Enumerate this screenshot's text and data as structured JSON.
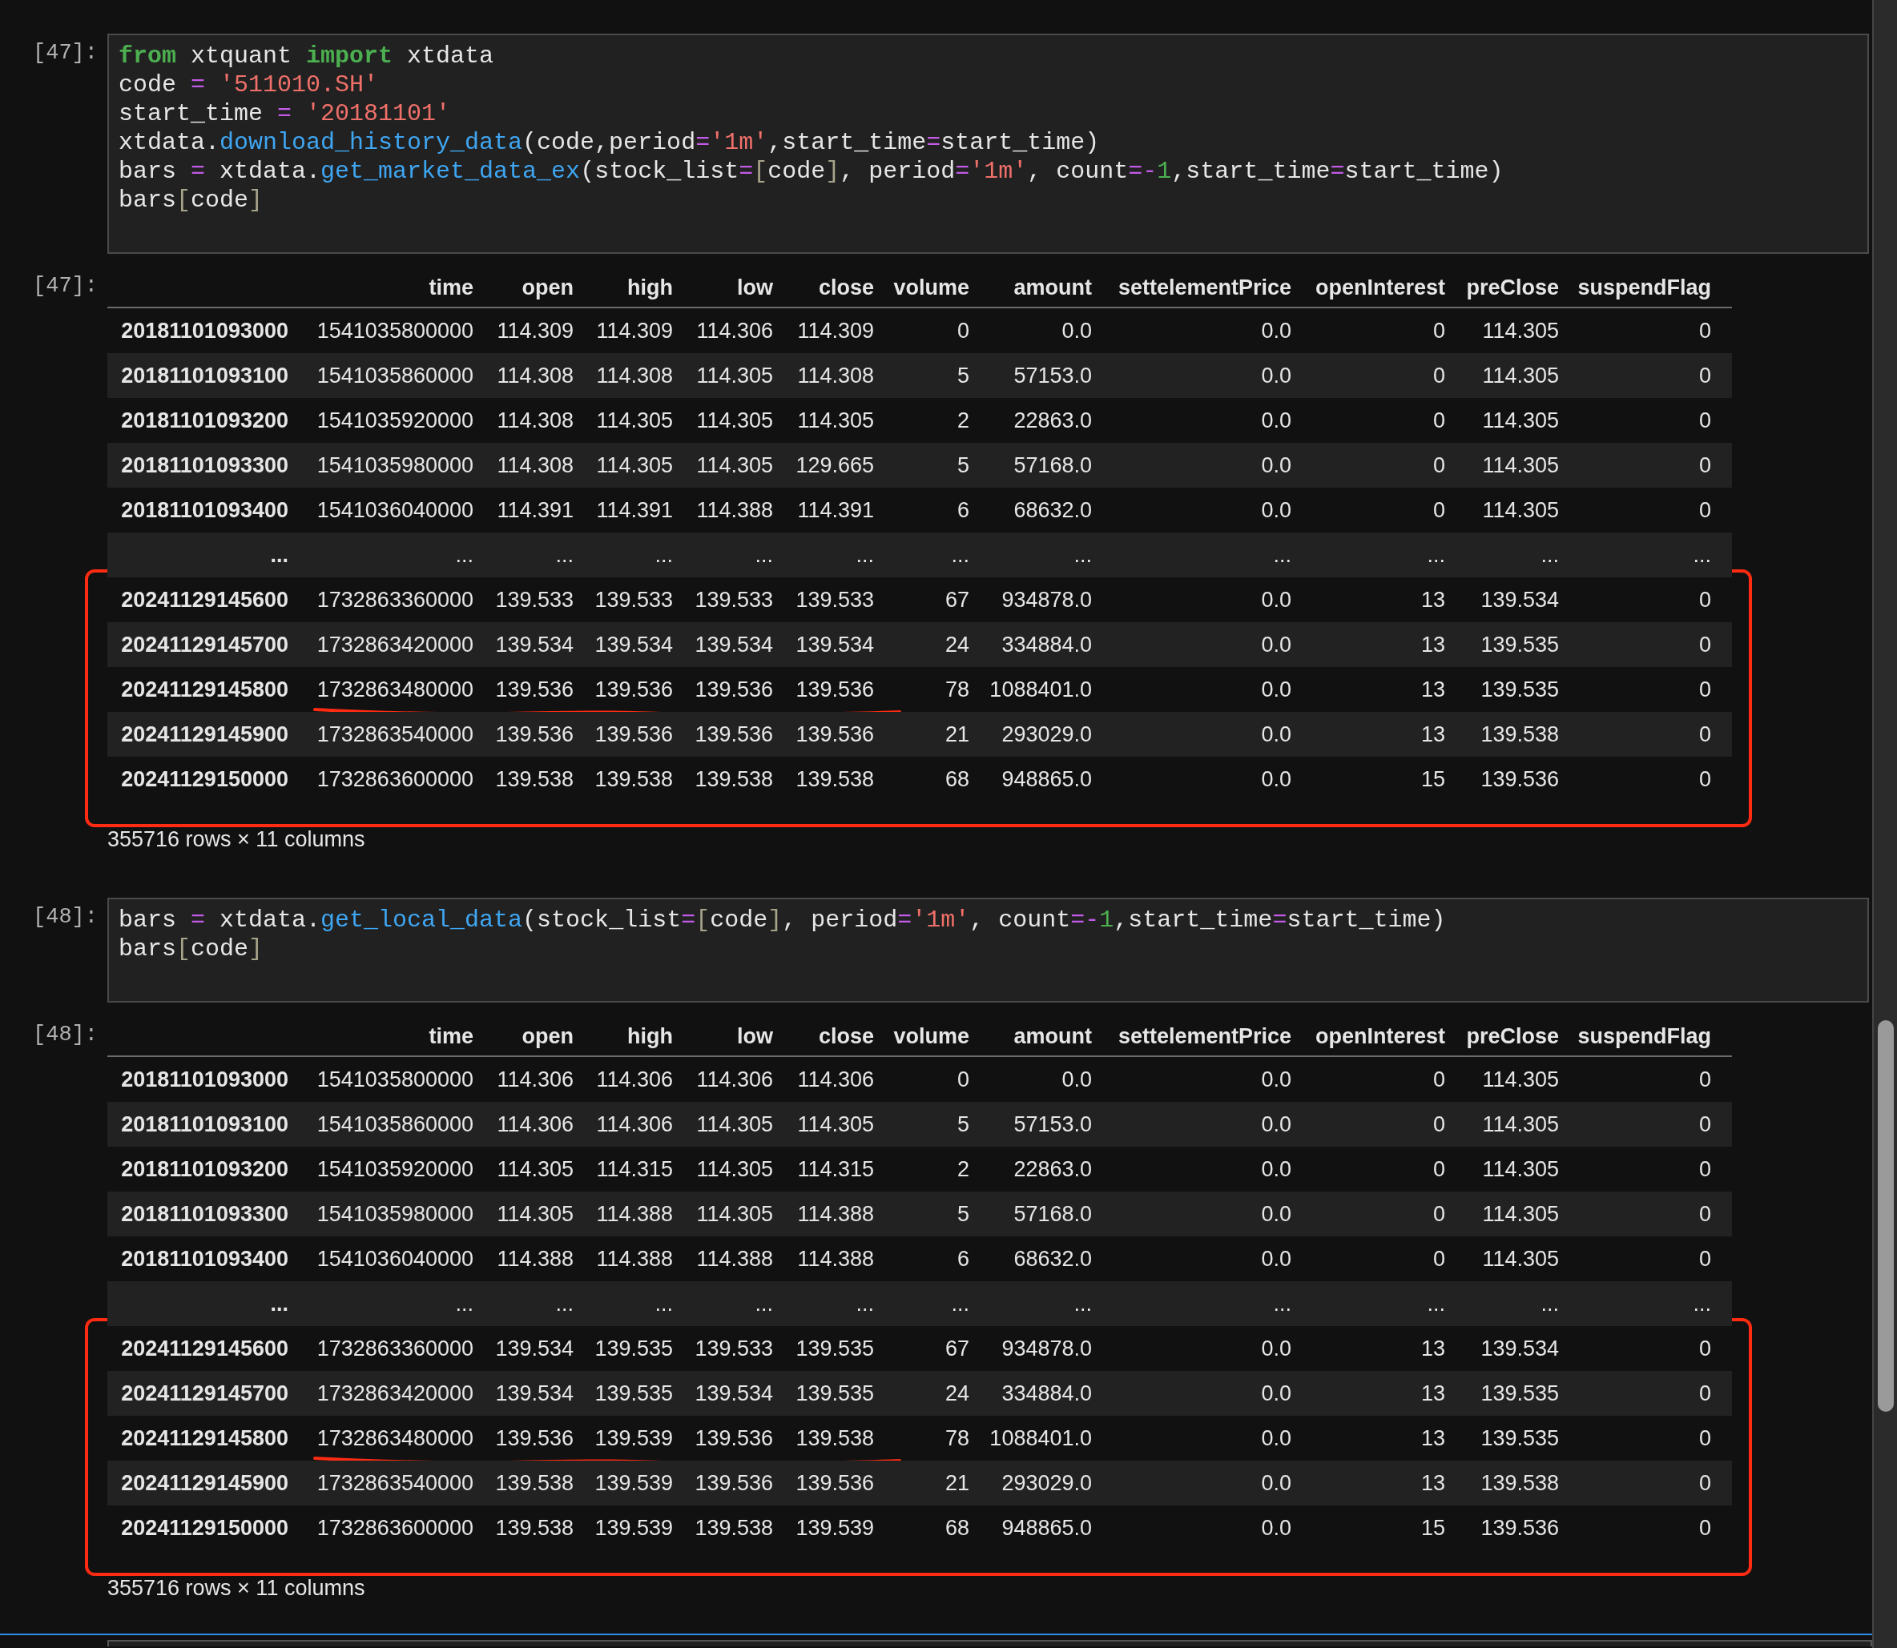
{
  "cells": [
    {
      "prompt": "[47]:",
      "code": [
        [
          {
            "kind": "keyword",
            "text": "from"
          },
          {
            "kind": "plain",
            "text": " xtquant "
          },
          {
            "kind": "keyword",
            "text": "import"
          },
          {
            "kind": "plain",
            "text": " xtdata"
          }
        ],
        [
          {
            "kind": "plain",
            "text": "code "
          },
          {
            "kind": "operator",
            "text": "="
          },
          {
            "kind": "string",
            "text": " '511010.SH'"
          }
        ],
        [
          {
            "kind": "plain",
            "text": "start_time "
          },
          {
            "kind": "operator",
            "text": "="
          },
          {
            "kind": "string",
            "text": " '20181101'"
          }
        ],
        [
          {
            "kind": "plain",
            "text": "xtdata."
          },
          {
            "kind": "function",
            "text": "download_history_data"
          },
          {
            "kind": "plain",
            "text": "(code,period"
          },
          {
            "kind": "operator",
            "text": "="
          },
          {
            "kind": "string",
            "text": "'1m'"
          },
          {
            "kind": "plain",
            "text": ",start_time"
          },
          {
            "kind": "operator",
            "text": "="
          },
          {
            "kind": "plain",
            "text": "start_time)"
          }
        ],
        [
          {
            "kind": "plain",
            "text": "bars "
          },
          {
            "kind": "operator",
            "text": "="
          },
          {
            "kind": "plain",
            "text": " xtdata."
          },
          {
            "kind": "function",
            "text": "get_market_data_ex"
          },
          {
            "kind": "plain",
            "text": "(stock_list"
          },
          {
            "kind": "operator",
            "text": "="
          },
          {
            "kind": "bracket",
            "text": "["
          },
          {
            "kind": "plain",
            "text": "code"
          },
          {
            "kind": "bracket",
            "text": "]"
          },
          {
            "kind": "plain",
            "text": ", period"
          },
          {
            "kind": "operator",
            "text": "="
          },
          {
            "kind": "string",
            "text": "'1m'"
          },
          {
            "kind": "plain",
            "text": ", count"
          },
          {
            "kind": "operator",
            "text": "=-"
          },
          {
            "kind": "number",
            "text": "1"
          },
          {
            "kind": "plain",
            "text": ",start_time"
          },
          {
            "kind": "operator",
            "text": "="
          },
          {
            "kind": "plain",
            "text": "start_time)"
          }
        ],
        [
          {
            "kind": "plain",
            "text": "bars"
          },
          {
            "kind": "bracket",
            "text": "["
          },
          {
            "kind": "plain",
            "text": "code"
          },
          {
            "kind": "bracket",
            "text": "]"
          }
        ]
      ],
      "output": {
        "prompt": "[47]:",
        "columns": [
          "time",
          "open",
          "high",
          "low",
          "close",
          "volume",
          "amount",
          "settelementPrice",
          "openInterest",
          "preClose",
          "suspendFlag"
        ],
        "rows": [
          {
            "index": "20181101093000",
            "cells": [
              "1541035800000",
              "114.309",
              "114.309",
              "114.306",
              "114.309",
              "0",
              "0.0",
              "0.0",
              "0",
              "114.305",
              "0"
            ]
          },
          {
            "index": "20181101093100",
            "cells": [
              "1541035860000",
              "114.308",
              "114.308",
              "114.305",
              "114.308",
              "5",
              "57153.0",
              "0.0",
              "0",
              "114.305",
              "0"
            ]
          },
          {
            "index": "20181101093200",
            "cells": [
              "1541035920000",
              "114.308",
              "114.305",
              "114.305",
              "114.305",
              "2",
              "22863.0",
              "0.0",
              "0",
              "114.305",
              "0"
            ]
          },
          {
            "index": "20181101093300",
            "cells": [
              "1541035980000",
              "114.308",
              "114.305",
              "114.305",
              "129.665",
              "5",
              "57168.0",
              "0.0",
              "0",
              "114.305",
              "0"
            ]
          },
          {
            "index": "20181101093400",
            "cells": [
              "1541036040000",
              "114.391",
              "114.391",
              "114.388",
              "114.391",
              "6",
              "68632.0",
              "0.0",
              "0",
              "114.305",
              "0"
            ]
          },
          {
            "index": "...",
            "cells": [
              "...",
              "...",
              "...",
              "...",
              "...",
              "...",
              "...",
              "...",
              "...",
              "...",
              "..."
            ]
          }
        ],
        "highlight": {
          "rows": [
            {
              "index": "20241129145600",
              "cells": [
                "1732863360000",
                "139.533",
                "139.533",
                "139.533",
                "139.533",
                "67",
                "934878.0",
                "0.0",
                "13",
                "139.534",
                "0"
              ],
              "underlined": false
            },
            {
              "index": "20241129145700",
              "cells": [
                "1732863420000",
                "139.534",
                "139.534",
                "139.534",
                "139.534",
                "24",
                "334884.0",
                "0.0",
                "13",
                "139.535",
                "0"
              ],
              "underlined": false
            },
            {
              "index": "20241129145800",
              "cells": [
                "1732863480000",
                "139.536",
                "139.536",
                "139.536",
                "139.536",
                "78",
                "1088401.0",
                "0.0",
                "13",
                "139.535",
                "0"
              ],
              "underlined": true
            },
            {
              "index": "20241129145900",
              "cells": [
                "1732863540000",
                "139.536",
                "139.536",
                "139.536",
                "139.536",
                "21",
                "293029.0",
                "0.0",
                "13",
                "139.538",
                "0"
              ],
              "underlined": false
            },
            {
              "index": "20241129150000",
              "cells": [
                "1732863600000",
                "139.538",
                "139.538",
                "139.538",
                "139.538",
                "68",
                "948865.0",
                "0.0",
                "15",
                "139.536",
                "0"
              ],
              "underlined": false
            }
          ]
        },
        "footer": "355716 rows × 11 columns"
      }
    },
    {
      "prompt": "[48]:",
      "code": [
        [
          {
            "kind": "plain",
            "text": "bars "
          },
          {
            "kind": "operator",
            "text": "="
          },
          {
            "kind": "plain",
            "text": " xtdata."
          },
          {
            "kind": "function",
            "text": "get_local_data"
          },
          {
            "kind": "plain",
            "text": "(stock_list"
          },
          {
            "kind": "operator",
            "text": "="
          },
          {
            "kind": "bracket",
            "text": "["
          },
          {
            "kind": "plain",
            "text": "code"
          },
          {
            "kind": "bracket",
            "text": "]"
          },
          {
            "kind": "plain",
            "text": ", period"
          },
          {
            "kind": "operator",
            "text": "="
          },
          {
            "kind": "string",
            "text": "'1m'"
          },
          {
            "kind": "plain",
            "text": ", count"
          },
          {
            "kind": "operator",
            "text": "=-"
          },
          {
            "kind": "number",
            "text": "1"
          },
          {
            "kind": "plain",
            "text": ",start_time"
          },
          {
            "kind": "operator",
            "text": "="
          },
          {
            "kind": "plain",
            "text": "start_time)"
          }
        ],
        [
          {
            "kind": "plain",
            "text": "bars"
          },
          {
            "kind": "bracket",
            "text": "["
          },
          {
            "kind": "plain",
            "text": "code"
          },
          {
            "kind": "bracket",
            "text": "]"
          }
        ]
      ],
      "output": {
        "prompt": "[48]:",
        "columns": [
          "time",
          "open",
          "high",
          "low",
          "close",
          "volume",
          "amount",
          "settelementPrice",
          "openInterest",
          "preClose",
          "suspendFlag"
        ],
        "rows": [
          {
            "index": "20181101093000",
            "cells": [
              "1541035800000",
              "114.306",
              "114.306",
              "114.306",
              "114.306",
              "0",
              "0.0",
              "0.0",
              "0",
              "114.305",
              "0"
            ]
          },
          {
            "index": "20181101093100",
            "cells": [
              "1541035860000",
              "114.306",
              "114.306",
              "114.305",
              "114.305",
              "5",
              "57153.0",
              "0.0",
              "0",
              "114.305",
              "0"
            ]
          },
          {
            "index": "20181101093200",
            "cells": [
              "1541035920000",
              "114.305",
              "114.315",
              "114.305",
              "114.315",
              "2",
              "22863.0",
              "0.0",
              "0",
              "114.305",
              "0"
            ]
          },
          {
            "index": "20181101093300",
            "cells": [
              "1541035980000",
              "114.305",
              "114.388",
              "114.305",
              "114.388",
              "5",
              "57168.0",
              "0.0",
              "0",
              "114.305",
              "0"
            ]
          },
          {
            "index": "20181101093400",
            "cells": [
              "1541036040000",
              "114.388",
              "114.388",
              "114.388",
              "114.388",
              "6",
              "68632.0",
              "0.0",
              "0",
              "114.305",
              "0"
            ]
          },
          {
            "index": "...",
            "cells": [
              "...",
              "...",
              "...",
              "...",
              "...",
              "...",
              "...",
              "...",
              "...",
              "...",
              "..."
            ]
          }
        ],
        "highlight": {
          "rows": [
            {
              "index": "20241129145600",
              "cells": [
                "1732863360000",
                "139.534",
                "139.535",
                "139.533",
                "139.535",
                "67",
                "934878.0",
                "0.0",
                "13",
                "139.534",
                "0"
              ],
              "underlined": false
            },
            {
              "index": "20241129145700",
              "cells": [
                "1732863420000",
                "139.534",
                "139.535",
                "139.534",
                "139.535",
                "24",
                "334884.0",
                "0.0",
                "13",
                "139.535",
                "0"
              ],
              "underlined": false
            },
            {
              "index": "20241129145800",
              "cells": [
                "1732863480000",
                "139.536",
                "139.539",
                "139.536",
                "139.538",
                "78",
                "1088401.0",
                "0.0",
                "13",
                "139.535",
                "0"
              ],
              "underlined": true
            },
            {
              "index": "20241129145900",
              "cells": [
                "1732863540000",
                "139.538",
                "139.539",
                "139.536",
                "139.536",
                "21",
                "293029.0",
                "0.0",
                "13",
                "139.538",
                "0"
              ],
              "underlined": false
            },
            {
              "index": "20241129150000",
              "cells": [
                "1732863600000",
                "139.538",
                "139.539",
                "139.538",
                "139.539",
                "68",
                "948865.0",
                "0.0",
                "15",
                "139.536",
                "0"
              ],
              "underlined": false
            }
          ]
        },
        "footer": "355716 rows × 11 columns"
      }
    }
  ]
}
